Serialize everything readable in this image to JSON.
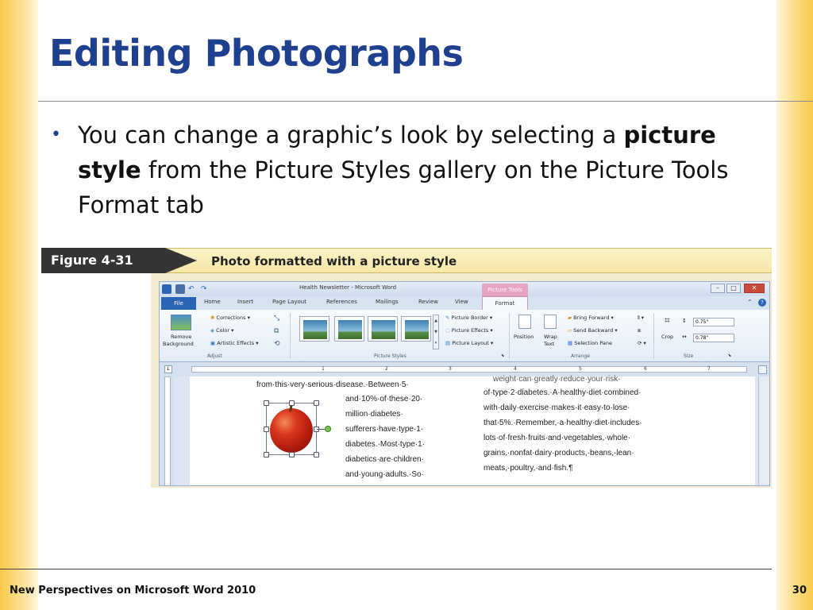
{
  "slide": {
    "title": "Editing Photographs",
    "bullet_part1": "You can change a graphic’s look by selecting a ",
    "bullet_bold": "picture style",
    "bullet_part2": " from the Picture Styles gallery on the Picture Tools Format tab",
    "footer_left": "New Perspectives on Microsoft Word 2010",
    "page_number": "30",
    "colors": {
      "title": "#1f3f8f",
      "gold": "#f7c94a"
    }
  },
  "figure": {
    "label": "Figure 4-31",
    "caption": "Photo formatted with a picture style"
  },
  "word": {
    "window_title": "Health Newsletter - Microsoft Word",
    "context_tab": "Picture Tools",
    "tabs": [
      "File",
      "Home",
      "Insert",
      "Page Layout",
      "References",
      "Mailings",
      "Review",
      "View",
      "Format"
    ],
    "adjust": {
      "remove_bg_1": "Remove",
      "remove_bg_2": "Background",
      "corrections": "Corrections",
      "color": "Color",
      "artistic_effects": "Artistic Effects",
      "group": "Adjust"
    },
    "picture_styles": {
      "group": "Picture Styles",
      "border": "Picture Border",
      "effects": "Picture Effects",
      "layout": "Picture Layout"
    },
    "arrange": {
      "position": "Position",
      "wrap_1": "Wrap",
      "wrap_2": "Text",
      "bring_forward": "Bring Forward",
      "send_backward": "Send Backward",
      "selection_pane": "Selection Pane",
      "group": "Arrange"
    },
    "size": {
      "crop": "Crop",
      "height": "0.75\"",
      "width": "0.78\"",
      "group": "Size"
    },
    "ruler_numbers": [
      "1",
      "2",
      "3",
      "4",
      "5",
      "6",
      "7"
    ],
    "doc_left": [
      "from·this·very·serious·disease.·Between·5·",
      "and·10%·of·these·20·",
      "million·diabetes·",
      "sufferers·have·type·1·",
      "diabetes.·Most·type·1·",
      "diabetics·are·children·",
      "and·young·adults.·So·"
    ],
    "doc_right": [
      "weight·can·greatly·reduce·your·risk·",
      "of·type·2·diabetes.·A·healthy·diet·combined·",
      "with·daily·exercise·makes·it·easy·to·lose·",
      "that·5%.·Remember,·a·healthy·diet·includes·",
      "lots·of·fresh·fruits·and·vegetables,·whole·",
      "grains,·nonfat·dairy·products,·beans,·lean·",
      "meats,·poultry,·and·fish.¶"
    ]
  }
}
